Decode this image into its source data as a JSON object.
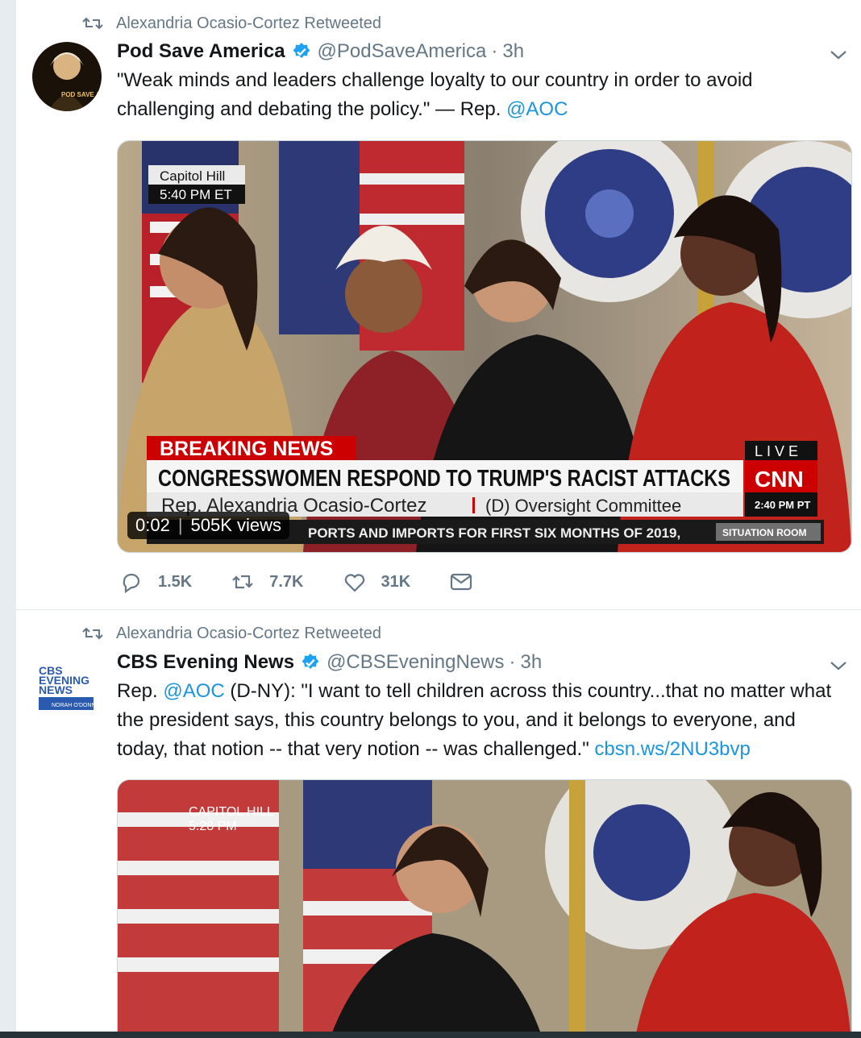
{
  "tweets": [
    {
      "retweet_label": "Alexandria Ocasio-Cortez Retweeted",
      "display_name": "Pod Save America",
      "handle": "@PodSaveAmerica",
      "separator": "·",
      "time": "3h",
      "text_before": "\"Weak minds and leaders challenge loyalty to our country in order to avoid challenging and debating the policy.\" — Rep. ",
      "mention": "@AOC",
      "avatar_text": "POD SAVE AMERIC",
      "media": {
        "location_line1": "Capitol Hill",
        "location_line2": "5:40 PM ET",
        "breaking": "BREAKING NEWS",
        "live": "LIVE",
        "headline": "CONGRESSWOMEN RESPOND TO TRUMP'S RACIST ATTACKS",
        "network": "CNN",
        "subtitle_name": "Rep. Alexandria Ocasio-Cortez",
        "subtitle_role": "(D) Oversight Committee",
        "pt_time": "2:40 PM PT",
        "ticker": "PORTS AND IMPORTS FOR FIRST SIX MONTHS OF 2019,",
        "show": "SITUATION ROOM",
        "duration": "0:02",
        "views": "505K views"
      },
      "actions": {
        "replies": "1.5K",
        "retweets": "7.7K",
        "likes": "31K"
      }
    },
    {
      "retweet_label": "Alexandria Ocasio-Cortez Retweeted",
      "display_name": "CBS Evening News",
      "handle": "@CBSEveningNews",
      "separator": "·",
      "time": "3h",
      "text_part1": "Rep. ",
      "mention": "@AOC",
      "text_part2": " (D-NY): \"I want to tell children across this country...that no matter what the president says, this country belongs to you, and it belongs to everyone, and today, that notion -- that very notion -- was challenged.\" ",
      "link": "cbsn.ws/2NU3bvp",
      "logo_lines": [
        "CBS",
        "EVENING",
        "NEWS",
        "NORAH O'DONNELL"
      ],
      "media": {
        "location_line1": "CAPITOL HILL",
        "location_line2": "5:28 PM"
      }
    }
  ],
  "colors": {
    "link": "#1b95e0",
    "muted": "#657786",
    "verified": "#1da1f2",
    "cnn_red": "#cc0000"
  }
}
